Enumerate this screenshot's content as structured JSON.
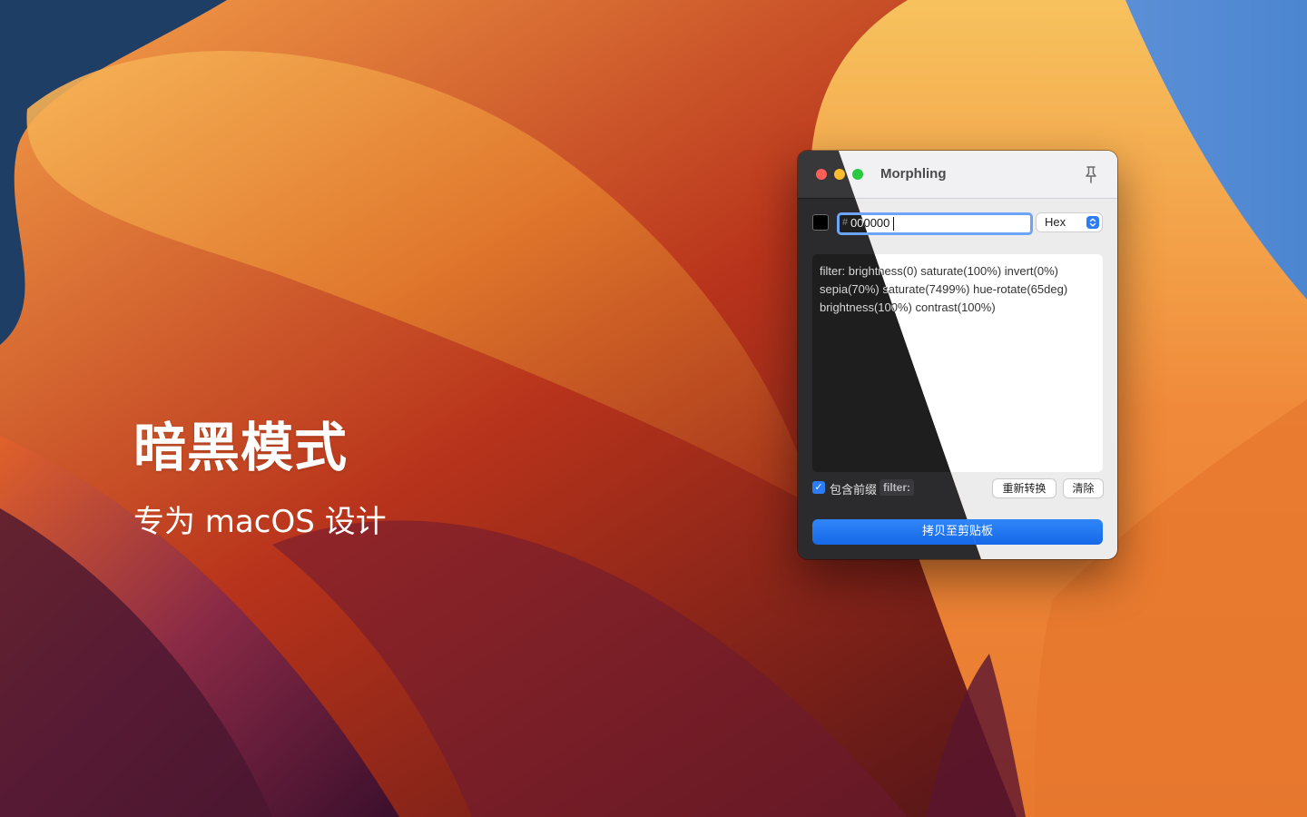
{
  "hero": {
    "title": "暗黑模式",
    "subtitle": "专为 macOS 设计"
  },
  "window": {
    "title": "Morphling",
    "pin_icon": "pin-icon",
    "color": {
      "swatch_color": "#000000",
      "hash": "#",
      "value": "000000",
      "format": "Hex"
    },
    "output_lines": [
      "filter: brightness(0) saturate(100%) invert(0%)",
      "sepia(70%) saturate(7499%) hue-rotate(65deg)",
      "brightness(100%) contrast(100%)"
    ],
    "prefix": {
      "checked": true,
      "label": "包含前缀",
      "code": "filter:"
    },
    "buttons": {
      "reconvert": "重新转换",
      "clear": "清除",
      "copy": "拷贝至剪贴板"
    }
  },
  "colors": {
    "accent": "#2b7cf6",
    "close": "#fe5f57",
    "minimize": "#febc2e",
    "zoom": "#28c840"
  }
}
